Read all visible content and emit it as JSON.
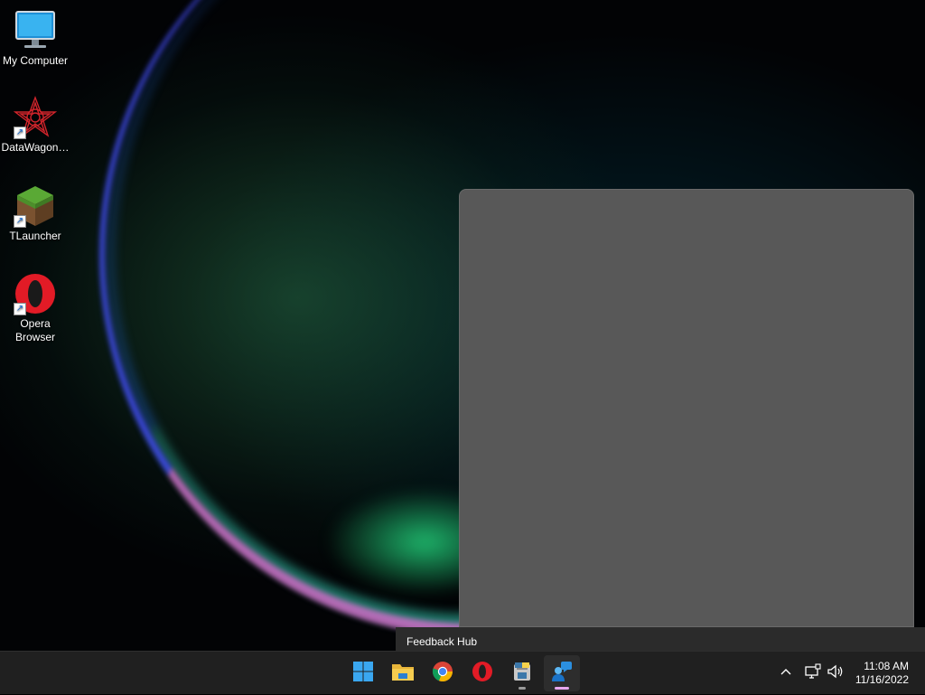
{
  "desktop": {
    "icons": [
      {
        "label": "My Computer",
        "icon": "monitor-icon"
      },
      {
        "label": "DataWagon…",
        "icon": "datawagon-icon",
        "shortcut": true
      },
      {
        "label": "TLauncher",
        "icon": "minecraft-grass-block-icon",
        "shortcut": true
      },
      {
        "label": "Opera Browser",
        "icon": "opera-icon",
        "shortcut": true
      }
    ]
  },
  "tooltip": {
    "text": "Feedback Hub"
  },
  "taskbar": {
    "apps": [
      {
        "name": "Start",
        "icon": "windows-start-icon"
      },
      {
        "name": "File Explorer",
        "icon": "folder-icon"
      },
      {
        "name": "Google Chrome",
        "icon": "chrome-icon"
      },
      {
        "name": "Opera Browser",
        "icon": "opera-icon"
      },
      {
        "name": "Python",
        "icon": "python-disk-icon",
        "running": true
      },
      {
        "name": "Feedback Hub",
        "icon": "feedback-hub-icon",
        "running": true,
        "active": true
      }
    ],
    "tray": {
      "icons": [
        "chevron-up-icon",
        "network-icon",
        "volume-icon"
      ]
    },
    "clock": {
      "time": "11:08 AM",
      "date": "11/16/2022"
    }
  },
  "colors": {
    "taskbar": "#202020",
    "popup": "#585858",
    "tooltip": "#2b2b2b",
    "active_indicator": "#e8a7ef"
  }
}
